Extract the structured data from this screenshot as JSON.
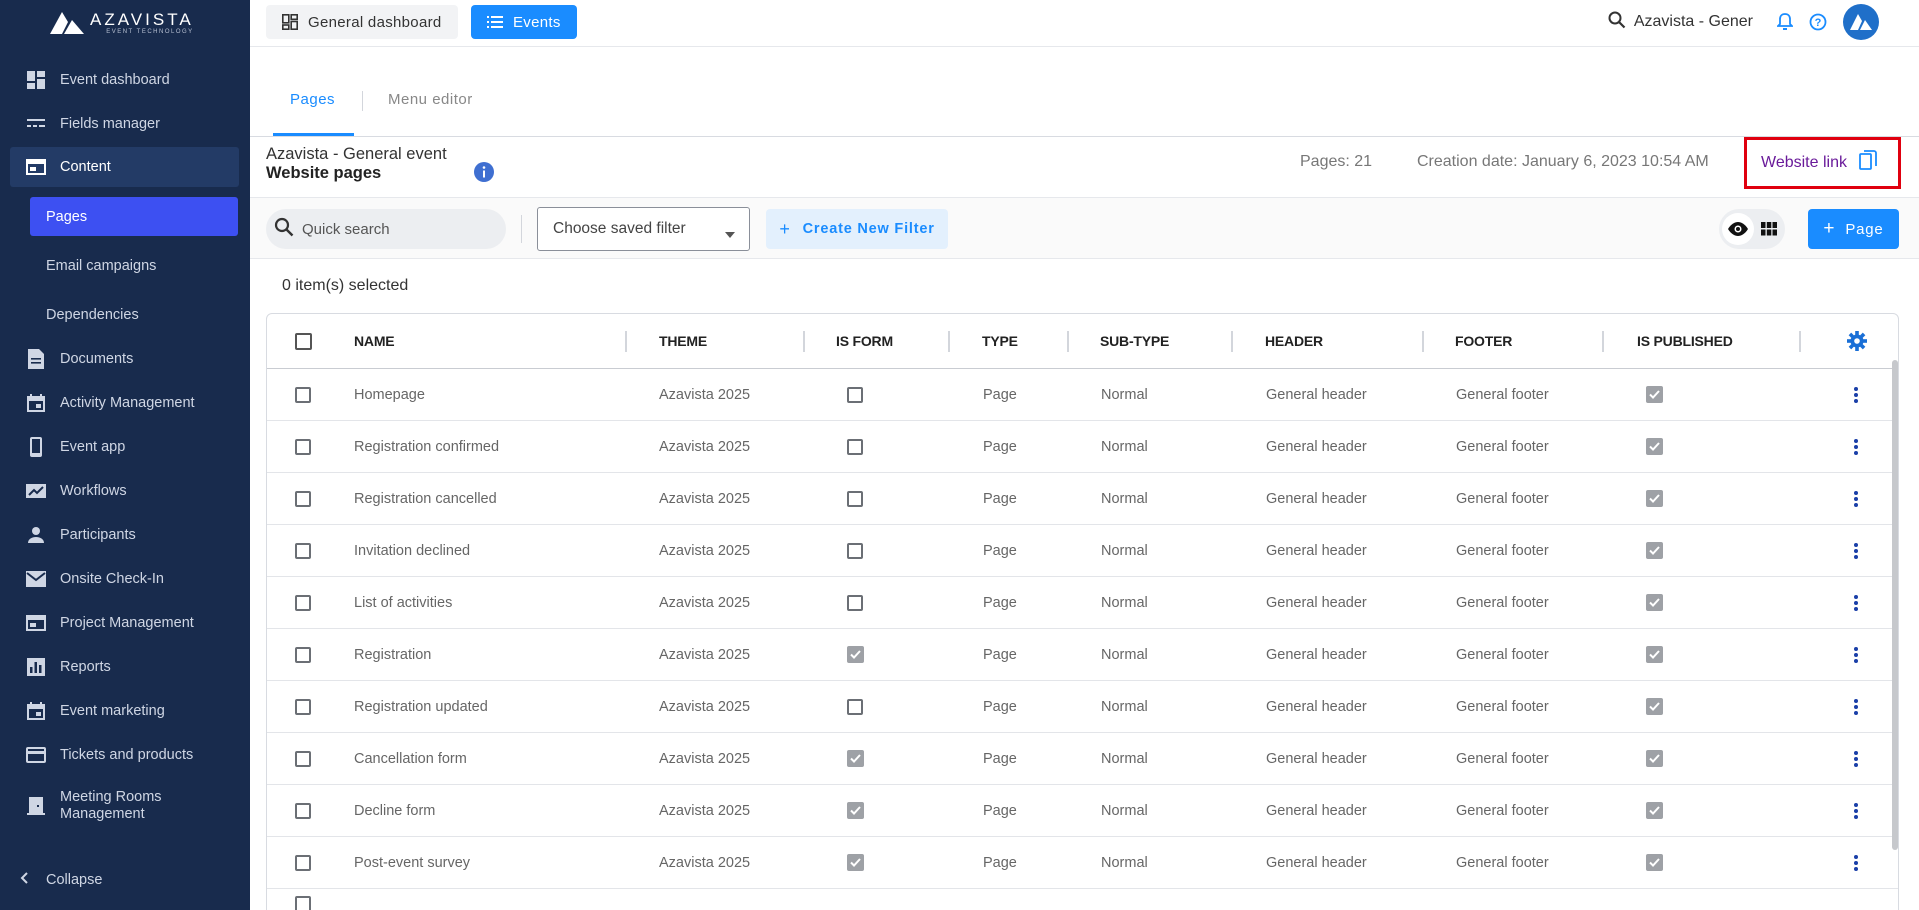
{
  "app": {
    "brand_name": "AZAVISTA",
    "brand_sub": "EVENT TECHNOLOGY"
  },
  "sidebar": {
    "items": [
      {
        "label": "Event dashboard",
        "icon": "dashboard-icon"
      },
      {
        "label": "Fields manager",
        "icon": "fields-icon"
      },
      {
        "label": "Content",
        "icon": "content-icon",
        "active": true
      },
      {
        "label": "Documents",
        "icon": "document-icon"
      },
      {
        "label": "Activity Management",
        "icon": "calendar-icon"
      },
      {
        "label": "Event app",
        "icon": "phone-icon"
      },
      {
        "label": "Workflows",
        "icon": "workflow-icon"
      },
      {
        "label": "Participants",
        "icon": "person-icon"
      },
      {
        "label": "Onsite Check-In",
        "icon": "mail-icon"
      },
      {
        "label": "Project Management",
        "icon": "project-icon"
      },
      {
        "label": "Reports",
        "icon": "reports-icon"
      },
      {
        "label": "Event marketing",
        "icon": "calendar-icon"
      },
      {
        "label": "Tickets and products",
        "icon": "ticket-icon"
      },
      {
        "label": "Meeting Rooms Management",
        "icon": "room-icon"
      }
    ],
    "subitems": [
      {
        "label": "Pages",
        "active": true
      },
      {
        "label": "Email campaigns"
      },
      {
        "label": "Dependencies"
      }
    ],
    "collapse_label": "Collapse"
  },
  "topbar": {
    "tab_general": "General dashboard",
    "tab_events": "Events",
    "org_name": "Azavista - Gener"
  },
  "subtabs": {
    "pages": "Pages",
    "menu_editor": "Menu editor"
  },
  "header": {
    "event_name": "Azavista - General event",
    "section_title": "Website pages",
    "pages_count": "Pages: 21",
    "creation_date": "Creation date: January 6, 2023 10:54 AM",
    "website_link": "Website link"
  },
  "toolbar": {
    "search_placeholder": "Quick search",
    "filter_placeholder": "Choose saved filter",
    "create_filter": "Create New Filter",
    "add_page": "Page"
  },
  "selected_count": "0 item(s) selected",
  "table": {
    "columns": [
      "NAME",
      "THEME",
      "IS FORM",
      "TYPE",
      "SUB-TYPE",
      "HEADER",
      "FOOTER",
      "IS PUBLISHED"
    ],
    "rows": [
      {
        "name": "Homepage",
        "theme": "Azavista 2025",
        "is_form": false,
        "type": "Page",
        "sub_type": "Normal",
        "header": "General header",
        "footer": "General footer",
        "is_published": true
      },
      {
        "name": "Registration confirmed",
        "theme": "Azavista 2025",
        "is_form": false,
        "type": "Page",
        "sub_type": "Normal",
        "header": "General header",
        "footer": "General footer",
        "is_published": true
      },
      {
        "name": "Registration cancelled",
        "theme": "Azavista 2025",
        "is_form": false,
        "type": "Page",
        "sub_type": "Normal",
        "header": "General header",
        "footer": "General footer",
        "is_published": true
      },
      {
        "name": "Invitation declined",
        "theme": "Azavista 2025",
        "is_form": false,
        "type": "Page",
        "sub_type": "Normal",
        "header": "General header",
        "footer": "General footer",
        "is_published": true
      },
      {
        "name": "List of activities",
        "theme": "Azavista 2025",
        "is_form": false,
        "type": "Page",
        "sub_type": "Normal",
        "header": "General header",
        "footer": "General footer",
        "is_published": true
      },
      {
        "name": "Registration",
        "theme": "Azavista 2025",
        "is_form": true,
        "type": "Page",
        "sub_type": "Normal",
        "header": "General header",
        "footer": "General footer",
        "is_published": true
      },
      {
        "name": "Registration updated",
        "theme": "Azavista 2025",
        "is_form": false,
        "type": "Page",
        "sub_type": "Normal",
        "header": "General header",
        "footer": "General footer",
        "is_published": true
      },
      {
        "name": "Cancellation form",
        "theme": "Azavista 2025",
        "is_form": true,
        "type": "Page",
        "sub_type": "Normal",
        "header": "General header",
        "footer": "General footer",
        "is_published": true
      },
      {
        "name": "Decline form",
        "theme": "Azavista 2025",
        "is_form": true,
        "type": "Page",
        "sub_type": "Normal",
        "header": "General header",
        "footer": "General footer",
        "is_published": true
      },
      {
        "name": "Post-event survey",
        "theme": "Azavista 2025",
        "is_form": true,
        "type": "Page",
        "sub_type": "Normal",
        "header": "General header",
        "footer": "General footer",
        "is_published": true
      }
    ]
  },
  "colors": {
    "sidebar_bg": "#182b4d",
    "accent": "#1a8cff",
    "active_sub": "#3d50f2",
    "highlight_box": "#e0000f",
    "link": "#6a1b9a"
  }
}
